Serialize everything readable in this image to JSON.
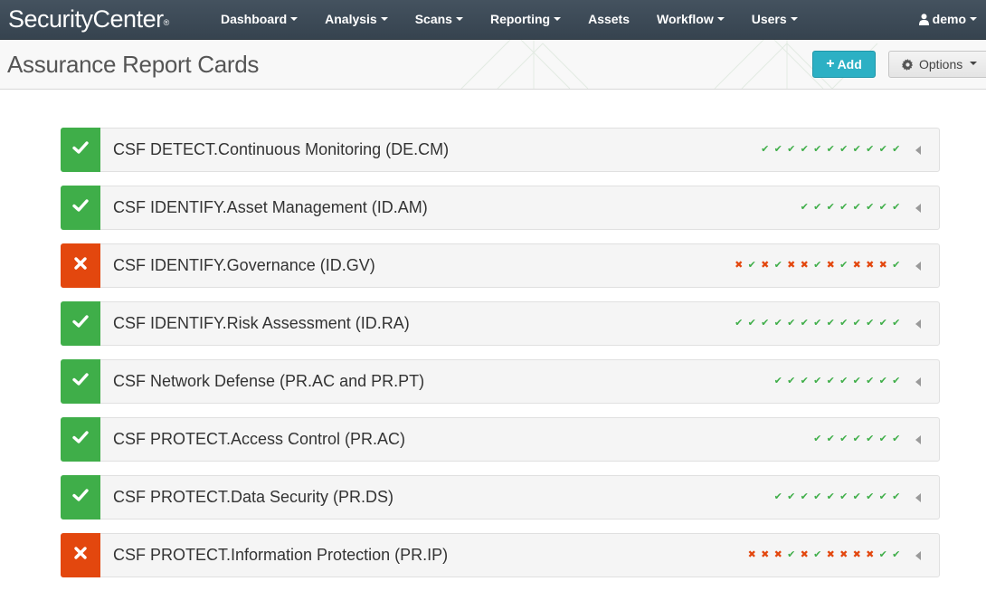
{
  "app": {
    "brand": "SecurityCenter",
    "brand_mark": "®"
  },
  "nav": {
    "items": [
      {
        "label": "Dashboard",
        "dropdown": true
      },
      {
        "label": "Analysis",
        "dropdown": true
      },
      {
        "label": "Scans",
        "dropdown": true
      },
      {
        "label": "Reporting",
        "dropdown": true
      },
      {
        "label": "Assets",
        "dropdown": false
      },
      {
        "label": "Workflow",
        "dropdown": true
      },
      {
        "label": "Users",
        "dropdown": true
      }
    ],
    "user": {
      "label": "demo",
      "icon": "user-icon"
    }
  },
  "header": {
    "title": "Assurance Report Cards",
    "add_label": "Add",
    "add_icon": "plus-icon",
    "options_label": "Options",
    "options_icon": "gear-icon"
  },
  "colors": {
    "pass": "#3fae49",
    "fail": "#e3470e",
    "accent": "#2cb0c4",
    "navbar": "#3d4a56"
  },
  "cards": [
    {
      "title": "CSF DETECT.Continuous Monitoring (DE.CM)",
      "status": "pass",
      "history": [
        "pass",
        "pass",
        "pass",
        "pass",
        "pass",
        "pass",
        "pass",
        "pass",
        "pass",
        "pass",
        "pass"
      ]
    },
    {
      "title": "CSF IDENTIFY.Asset Management (ID.AM)",
      "status": "pass",
      "history": [
        "pass",
        "pass",
        "pass",
        "pass",
        "pass",
        "pass",
        "pass",
        "pass"
      ]
    },
    {
      "title": "CSF IDENTIFY.Governance (ID.GV)",
      "status": "fail",
      "history": [
        "fail",
        "pass",
        "fail",
        "pass",
        "fail",
        "fail",
        "pass",
        "fail",
        "pass",
        "fail",
        "fail",
        "fail",
        "pass"
      ]
    },
    {
      "title": "CSF IDENTIFY.Risk Assessment (ID.RA)",
      "status": "pass",
      "history": [
        "pass",
        "pass",
        "pass",
        "pass",
        "pass",
        "pass",
        "pass",
        "pass",
        "pass",
        "pass",
        "pass",
        "pass",
        "pass"
      ]
    },
    {
      "title": "CSF Network Defense (PR.AC and PR.PT)",
      "status": "pass",
      "history": [
        "pass",
        "pass",
        "pass",
        "pass",
        "pass",
        "pass",
        "pass",
        "pass",
        "pass",
        "pass"
      ]
    },
    {
      "title": "CSF PROTECT.Access Control (PR.AC)",
      "status": "pass",
      "history": [
        "pass",
        "pass",
        "pass",
        "pass",
        "pass",
        "pass",
        "pass"
      ]
    },
    {
      "title": "CSF PROTECT.Data Security (PR.DS)",
      "status": "pass",
      "history": [
        "pass",
        "pass",
        "pass",
        "pass",
        "pass",
        "pass",
        "pass",
        "pass",
        "pass",
        "pass"
      ]
    },
    {
      "title": "CSF PROTECT.Information Protection (PR.IP)",
      "status": "fail",
      "history": [
        "fail",
        "fail",
        "fail",
        "pass",
        "fail",
        "pass",
        "fail",
        "fail",
        "fail",
        "fail",
        "pass",
        "pass"
      ]
    }
  ]
}
